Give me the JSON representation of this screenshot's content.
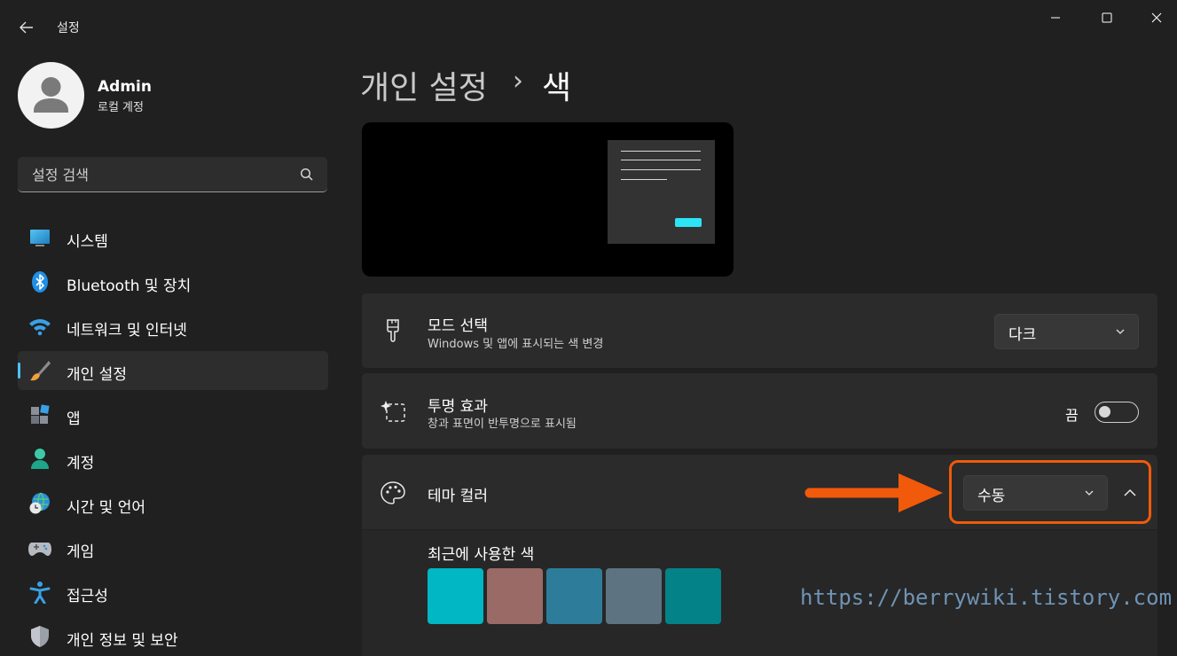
{
  "app": {
    "title": "설정"
  },
  "profile": {
    "name": "Admin",
    "account_type": "로컬 계정"
  },
  "search": {
    "placeholder": "설정 검색"
  },
  "sidebar": {
    "items": [
      {
        "label": "시스템",
        "icon": "system-monitor-icon"
      },
      {
        "label": "Bluetooth 및 장치",
        "icon": "bluetooth-icon"
      },
      {
        "label": "네트워크 및 인터넷",
        "icon": "wifi-icon"
      },
      {
        "label": "개인 설정",
        "icon": "paintbrush-icon",
        "selected": true
      },
      {
        "label": "앱",
        "icon": "apps-icon"
      },
      {
        "label": "계정",
        "icon": "person-icon"
      },
      {
        "label": "시간 및 언어",
        "icon": "globe-clock-icon"
      },
      {
        "label": "게임",
        "icon": "gamepad-icon"
      },
      {
        "label": "접근성",
        "icon": "accessibility-icon"
      },
      {
        "label": "개인 정보 및 보안",
        "icon": "shield-icon"
      }
    ]
  },
  "breadcrumb": {
    "parent": "개인 설정",
    "separator": "›",
    "current": "색"
  },
  "mode": {
    "title": "모드 선택",
    "subtitle": "Windows 및 앱에 표시되는 색 변경",
    "value": "다크"
  },
  "transparency": {
    "title": "투명 효과",
    "subtitle": "창과 표면이 반투명으로 표시됨",
    "state_label": "끔",
    "enabled": false
  },
  "theme_color": {
    "title": "테마 컬러",
    "value": "수동",
    "expanded": true,
    "recent_title": "최근에 사용한 색",
    "recent_colors": [
      "#00b7c3",
      "#9a6a67",
      "#2d7d9a",
      "#5d7381",
      "#038387"
    ]
  },
  "colors": {
    "accent": "#4cc2ff",
    "annotation": "#f05a0a"
  },
  "watermark": "https://berrywiki.tistory.com"
}
